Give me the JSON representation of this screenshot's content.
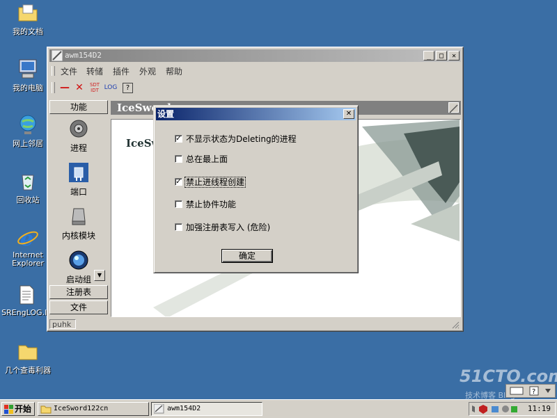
{
  "desktop": {
    "icons": [
      {
        "label": "我的文档",
        "icon": "folder-documents-icon"
      },
      {
        "label": "我的电脑",
        "icon": "computer-icon"
      },
      {
        "label": "网上邻居",
        "icon": "network-icon"
      },
      {
        "label": "回收站",
        "icon": "recycle-bin-icon"
      },
      {
        "label": "Internet Explorer",
        "icon": "ie-icon"
      },
      {
        "label": "SREngLOG.lo",
        "icon": "text-file-icon"
      },
      {
        "label": "几个查毒利器",
        "icon": "folder-icon"
      }
    ]
  },
  "window": {
    "title": "awm154D2",
    "menu": [
      "文件",
      "转储",
      "插件",
      "外观",
      "帮助"
    ],
    "toolbar": {
      "sdt_label": "SDT\nIDT",
      "log_label": "LOG"
    },
    "sidebar": {
      "header": "功能",
      "items": [
        {
          "label": "进程",
          "icon": "gear-icon"
        },
        {
          "label": "端口",
          "icon": "port-icon"
        },
        {
          "label": "内核模块",
          "icon": "module-icon"
        },
        {
          "label": "启动组",
          "icon": "startup-icon"
        }
      ],
      "bottom_headers": [
        "注册表",
        "文件"
      ]
    },
    "content_title": "IceSword",
    "content_brand": "IceSw",
    "status": "puhk"
  },
  "dialog": {
    "title": "设置",
    "options": [
      {
        "label": "不显示状态为Deleting的进程",
        "checked": true
      },
      {
        "label": "总在最上面",
        "checked": false
      },
      {
        "label": "禁止进线程创建",
        "checked": true
      },
      {
        "label": "禁止协件功能",
        "checked": false
      },
      {
        "label": "加强注册表写入 (危险)",
        "checked": false
      }
    ],
    "ok_label": "确定"
  },
  "taskbar": {
    "start_label": "开始",
    "tasks": [
      {
        "label": "IceSword122cn",
        "active": false
      },
      {
        "label": "awm154D2",
        "active": true
      }
    ],
    "clock": "11:19"
  },
  "watermark": {
    "line1": "51CTO.com",
    "line2": "技术博客 Blog"
  },
  "colors": {
    "desktop": "#3a6ea5",
    "dialog_title": "#0a246a",
    "window_face": "#d4d0c8"
  }
}
